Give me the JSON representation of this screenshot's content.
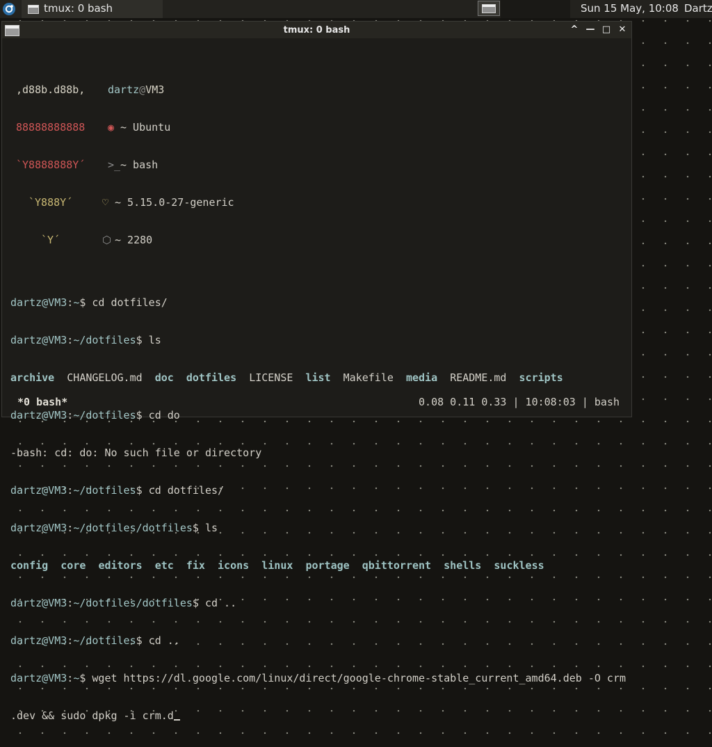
{
  "panel": {
    "start_icon": "distro-logo-icon",
    "taskbar_item_label": "tmux: 0 bash",
    "clock": "Sun 15 May, 10:08",
    "user": "Dartz"
  },
  "window": {
    "title": "tmux: 0 bash",
    "buttons": {
      "shade": "^",
      "minimize": "—",
      "maximize": "□",
      "close": "✕"
    }
  },
  "terminal": {
    "fetch": {
      "logo": [
        ",d88b.d88b,",
        "88888888888",
        "`Y8888888Y´",
        "`Y888Y´",
        "`Y´"
      ],
      "user": "dartz",
      "at": "@",
      "host": "VM3",
      "os": "~ Ubuntu",
      "shell": "~ bash",
      "kernel": "~ 5.15.0-27-generic",
      "packages": "~ 2280"
    },
    "prompt_user": "dartz@VM3",
    "lines": [
      {
        "path": "~",
        "cmd": " cd dotfiles/"
      },
      {
        "path": "~/dotfiles",
        "cmd": " ls"
      },
      {
        "path": "~/dotfiles",
        "cmd": " cd do"
      },
      {
        "path": "~/dotfiles",
        "cmd": " cd dotfiles/"
      },
      {
        "path": "~/dotfiles/dotfiles",
        "cmd": " ls"
      },
      {
        "path": "~/dotfiles/dotfiles",
        "cmd": " cd .."
      },
      {
        "path": "~/dotfiles",
        "cmd": " cd .."
      },
      {
        "path": "~",
        "cmd": " wget https://dl.google.com/linux/direct/google-chrome-stable_current_amd64.deb -O crm"
      }
    ],
    "ls1": [
      {
        "name": "archive",
        "dir": true
      },
      {
        "name": "CHANGELOG.md",
        "dir": false
      },
      {
        "name": "doc",
        "dir": true
      },
      {
        "name": "dotfiles",
        "dir": true
      },
      {
        "name": "LICENSE",
        "dir": false
      },
      {
        "name": "list",
        "dir": true
      },
      {
        "name": "Makefile",
        "dir": false
      },
      {
        "name": "media",
        "dir": true
      },
      {
        "name": "README.md",
        "dir": false
      },
      {
        "name": "scripts",
        "dir": true
      }
    ],
    "error": "-bash: cd: do: No such file or directory",
    "ls2": [
      "config",
      "core",
      "editors",
      "etc",
      "fix",
      "icons",
      "linux",
      "portage",
      "qbittorrent",
      "shells",
      "suckless"
    ],
    "wrap": ".dev && sudo dpkg -i crm.d"
  },
  "status": {
    "left": "*0 bash*",
    "right": "0.08 0.11 0.33 | 10:08:03 | bash"
  }
}
